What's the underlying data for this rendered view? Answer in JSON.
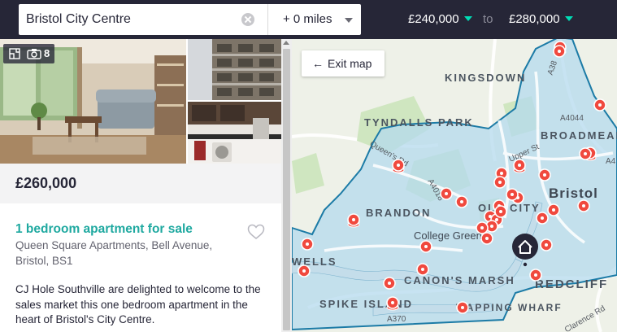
{
  "search": {
    "location_value": "Bristol City Centre",
    "clear_icon": "clear-icon",
    "radius_label": "+ 0 miles"
  },
  "price_filter": {
    "min_label": "£240,000",
    "to_label": "to",
    "max_label": "£280,000",
    "caret_color": "#00deb6"
  },
  "listing": {
    "media_count": "8",
    "media_icons": [
      "floorplan-icon",
      "camera-icon"
    ],
    "price": "£260,000",
    "title": "1 bedroom apartment for sale",
    "address": "Queen Square Apartments, Bell Avenue, Bristol, BS1",
    "description": "CJ Hole Southville are delighted to welcome to the sales market this one bedroom apartment in the heart of Bristol's City Centre.",
    "save_icon": "heart-icon"
  },
  "map": {
    "exit_label": "Exit map",
    "labels": {
      "kingsdown": "KINGSDOWN",
      "tyndalls_park": "TYNDALLS PARK",
      "brandon": "BRANDON",
      "old_city": "OLD CITY",
      "bristol": "Bristol",
      "broadmead": "BROADMEAD",
      "college_green": "College Green",
      "canons_marsh": "CANON'S MARSH",
      "spike_island": "SPIKE ISLAND",
      "wapping_wharf": "WAPPING WHARF",
      "redcliffe": "REDCLIFF",
      "wells": "WELLS",
      "queen_rd": "Queen's Rd",
      "upper_st": "Upper St",
      "a4044": "A4044",
      "a4018": "A4018",
      "a38": "A38",
      "a370": "A370",
      "clarence_rd": "Clarence Rd",
      "a4": "A4"
    },
    "colors": {
      "boundary": "#1c7ba6",
      "area_fill": "#b4d9ee",
      "pin": "#f0493e",
      "water": "#c4ddea",
      "park": "#cfe6c0",
      "home_marker": "#262637"
    },
    "pin_count": 34,
    "home_marker_icon": "home-icon"
  }
}
